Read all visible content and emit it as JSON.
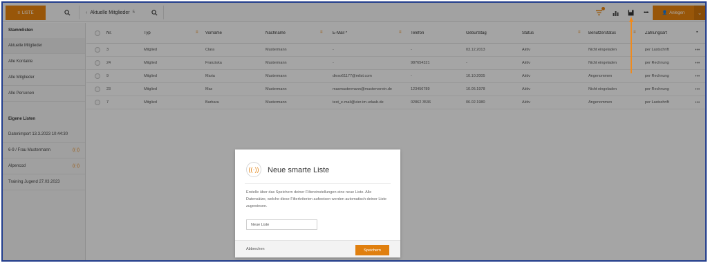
{
  "topbar": {
    "lists_label": "LISTE",
    "list_title": "Aktuelle Mitglieder",
    "list_count": "5",
    "add_label": "Anlegen"
  },
  "sidebar": {
    "section_standard": "Stammlisten",
    "standard_items": [
      "Aktuelle Mitglieder",
      "Alle Kontakte",
      "Alle Mitglieder",
      "Alle Personen"
    ],
    "section_own": "Eigene Listen",
    "own_items": [
      {
        "label": "Datenimport 13.3.2023 10:44:30",
        "smart": false
      },
      {
        "label": "6-9 / Frau Mustermann",
        "smart": true
      },
      {
        "label": "Alpencod",
        "smart": true
      },
      {
        "label": "Training Jugend 27.03.2023",
        "smart": false
      }
    ]
  },
  "table": {
    "headers": [
      "Nr.",
      "Typ",
      "Vorname",
      "Nachname",
      "E-Mail ^",
      "Telefon",
      "Geburtstag",
      "Status",
      "Benutzerstatus",
      "Zahlungsart"
    ],
    "rows": [
      [
        "3",
        "Mitglied",
        "Clara",
        "Mustermann",
        "-",
        "-",
        "03.12.2013",
        "Aktiv",
        "Nicht eingeladen",
        "per Lastschrift"
      ],
      [
        "24",
        "Mitglied",
        "Franziska",
        "Mustermann",
        "-",
        "987654321",
        "-",
        "Aktiv",
        "Nicht eingeladen",
        "per Rechnung"
      ],
      [
        "9",
        "Mitglied",
        "Maria",
        "Mustermann",
        "dieso61177@mlist.com",
        "-",
        "10.10.2005",
        "Aktiv",
        "Angenommen",
        "per Rechnung"
      ],
      [
        "23",
        "Mitglied",
        "Max",
        "Mustermann",
        "maxmustermann@musterverein.de",
        "123456789",
        "10.05.1978",
        "Aktiv",
        "Nicht eingeladen",
        "per Rechnung"
      ],
      [
        "7",
        "Mitglied",
        "Barbara",
        "Mustermann",
        "test_e-mail@vier-im-urlaub.de",
        "02862 3536",
        "06.02.1980",
        "Aktiv",
        "Angenommen",
        "per Lastschrift"
      ]
    ]
  },
  "dialog": {
    "title": "Neue smarte Liste",
    "description": "Erstelle über das Speichern deiner Filtereinstellungen eine neue Liste. Alle Datensätze, welche diese Filterkriterien aufweisen werden automatisch deiner Liste zugewiesen.",
    "input_value": "Neue Liste",
    "cancel_label": "Abbrechen",
    "save_label": "Speichern"
  },
  "colors": {
    "accent": "#e07f0e",
    "frame": "#1f3b8c"
  }
}
